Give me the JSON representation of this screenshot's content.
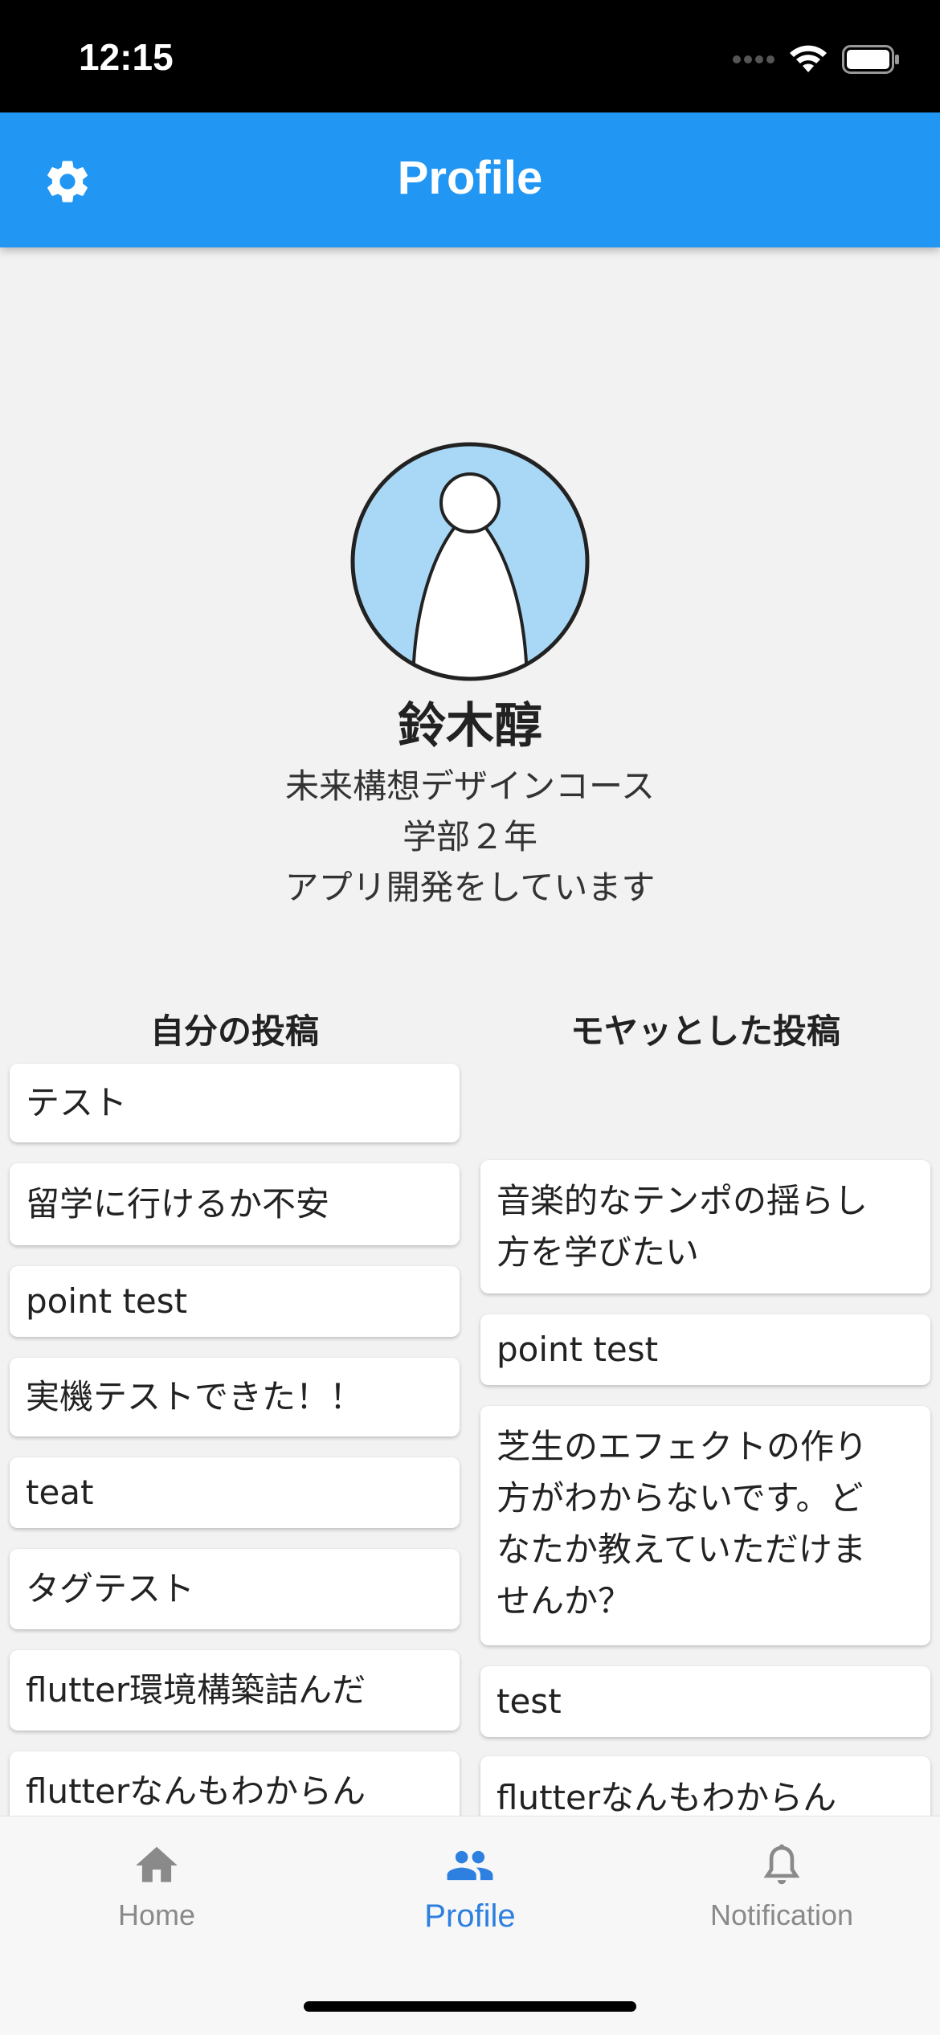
{
  "status_bar": {
    "time": "12:15",
    "icons": [
      "cellular-signal-icon",
      "wifi-icon",
      "battery-icon"
    ]
  },
  "app_bar": {
    "title": "Profile",
    "settings_icon": "gear-icon"
  },
  "profile": {
    "name": "鈴木醇",
    "course": "未来構想デザインコース",
    "grade": "学部２年",
    "bio": "アプリ開発をしています",
    "avatar_icon": "person-avatar-icon"
  },
  "my_posts": {
    "title": "自分の投稿",
    "items": [
      "テスト",
      "留学に行けるか不安",
      "point test",
      "実機テストできた！！",
      "teat",
      "タグテスト",
      "flutter環境構築詰んだ",
      "flutterなんもわからん"
    ]
  },
  "moyatto_posts": {
    "title": "モヤッとした投稿",
    "items": [
      [
        "音楽的なテンポの揺らし",
        "方を学びたい"
      ],
      [
        "point test"
      ],
      [
        "芝生のエフェクトの作り",
        "方がわからないです。ど",
        "なたか教えていただけま",
        "せんか？"
      ],
      [
        "test"
      ],
      [
        "flutterなんもわからん"
      ]
    ]
  },
  "bottom_nav": {
    "items": [
      {
        "label": "Home",
        "icon": "home-icon",
        "active": false
      },
      {
        "label": "Profile",
        "icon": "people-icon",
        "active": true
      },
      {
        "label": "Notification",
        "icon": "bell-icon",
        "active": false
      }
    ]
  },
  "colors": {
    "app_bar": "#2196f3",
    "active_nav": "#2d7fe0",
    "inactive_nav": "#8a8a8a",
    "avatar_bg": "#a8d8f5"
  }
}
